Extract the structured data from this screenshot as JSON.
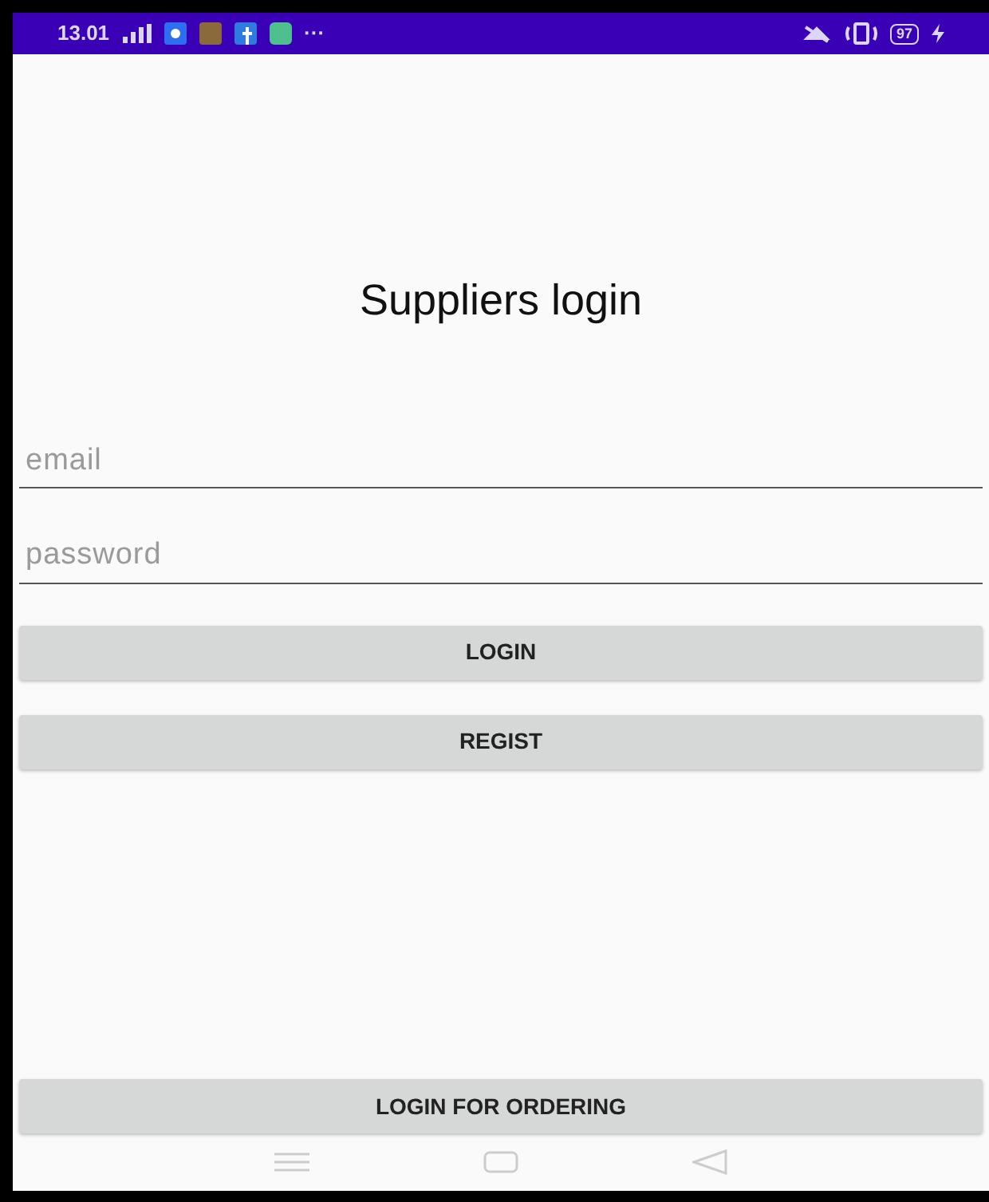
{
  "status_bar": {
    "time": "13.01",
    "more": "···",
    "battery": "97"
  },
  "title": "Suppliers login",
  "fields": [
    {
      "placeholder": "email"
    },
    {
      "placeholder": "password"
    }
  ],
  "buttons": [
    "LOGIN",
    "REGIST"
  ],
  "bottom_button": "LOGIN FOR ORDERING"
}
